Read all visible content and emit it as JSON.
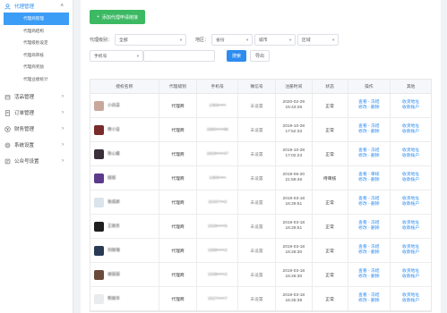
{
  "sidebar": {
    "groups": [
      {
        "label": "代理管理",
        "icon": "user-icon",
        "expanded": true
      },
      {
        "label": "活品管理",
        "icon": "box-icon"
      },
      {
        "label": "订单管理",
        "icon": "order-icon"
      },
      {
        "label": "财务管理",
        "icon": "money-icon"
      },
      {
        "label": "系统设置",
        "icon": "gear-icon"
      },
      {
        "label": "公众号设置",
        "icon": "wechat-icon"
      }
    ],
    "sub_items": [
      {
        "label": "代理商管理",
        "active": true
      },
      {
        "label": "代理商结构"
      },
      {
        "label": "代理级别设定"
      },
      {
        "label": "代理商审核"
      },
      {
        "label": "代理商奖励"
      },
      {
        "label": "代理业绩统计"
      }
    ]
  },
  "toolbar": {
    "add_label": "添加代理申请链接"
  },
  "filters": {
    "level_label": "代理级别：",
    "level_value": "全部",
    "region_label": "地区：",
    "province": "省份",
    "city": "城市",
    "district": "区域",
    "phone_select": "手机号",
    "search_label": "搜索",
    "export_label": "导出"
  },
  "table": {
    "headers": [
      "授权名称",
      "代理级别",
      "手机号",
      "微信号",
      "注册时间",
      "状态",
      "操作",
      "其他"
    ],
    "rows": [
      {
        "name": "小白菜",
        "level": "代理商",
        "phone": "1369•••••",
        "wechat": "未设置",
        "date": "2020-02-29",
        "time": "15:43:26",
        "status": "正常",
        "op1": "查看 - 冻结",
        "op2": "修改 - 删除",
        "other1": "收货地址",
        "other2": "收款账户",
        "avatar": "#c9a79a"
      },
      {
        "name": "荷小豆",
        "level": "代理商",
        "phone": "1890•••••86",
        "wechat": "未设置",
        "date": "2019-10-28",
        "time": "17:52:33",
        "status": "正常",
        "op1": "查看 - 冻结",
        "op2": "修改 - 删除",
        "other1": "收货地址",
        "other2": "收款账户",
        "avatar": "#7a2b2b"
      },
      {
        "name": "张心媛",
        "level": "代理商",
        "phone": "1829•••••47",
        "wechat": "未设置",
        "date": "2019-10-28",
        "time": "17:02:23",
        "status": "正常",
        "op1": "查看 - 冻结",
        "op2": "修改 - 删除",
        "other1": "收货地址",
        "other2": "收款账户",
        "avatar": "#3b2f3a"
      },
      {
        "name": "妞妞",
        "level": "代理商",
        "phone": "1369•••••",
        "wechat": "未设置",
        "date": "2019-06-20",
        "time": "21:59:46",
        "status": "待审核",
        "op1": "查看 - 审核",
        "op2": "修改 - 删除",
        "other1": "收货地址",
        "other2": "收款账户",
        "avatar": "#5c3a8c"
      },
      {
        "name": "张成新",
        "level": "代理商",
        "phone": "15347•••2",
        "wechat": "未设置",
        "date": "2019-03-18",
        "time": "16:29:51",
        "status": "正常",
        "op1": "查看 - 冻结",
        "op2": "修改 - 删除",
        "other1": "收货地址",
        "other2": "收款账户",
        "avatar": "#d9e4ec"
      },
      {
        "name": "王晓东",
        "level": "代理商",
        "phone": "1528•••••5",
        "wechat": "未设置",
        "date": "2019-03-18",
        "time": "16:29:51",
        "status": "正常",
        "op1": "查看 - 冻结",
        "op2": "修改 - 删除",
        "other1": "收货地址",
        "other2": "收款账户",
        "avatar": "#1f1f1f"
      },
      {
        "name": "刘晓瑞",
        "level": "代理商",
        "phone": "1588•••••2",
        "wechat": "未设置",
        "date": "2019-03-18",
        "time": "16:28:30",
        "status": "正常",
        "op1": "查看 - 冻结",
        "op2": "修改 - 删除",
        "other1": "收货地址",
        "other2": "收款账户",
        "avatar": "#2a3a55"
      },
      {
        "name": "谢丽丽",
        "level": "代理商",
        "phone": "1539•••••2",
        "wechat": "未设置",
        "date": "2019-03-18",
        "time": "16:26:30",
        "status": "正常",
        "op1": "查看 - 冻结",
        "op2": "修改 - 删除",
        "other1": "收货地址",
        "other2": "收款账户",
        "avatar": "#6b4a3a"
      },
      {
        "name": "熊晓华",
        "level": "代理商",
        "phone": "1527•••••7",
        "wechat": "未设置",
        "date": "2019-03-18",
        "time": "16:25:39",
        "status": "正常",
        "op1": "查看 - 冻结",
        "op2": "修改 - 删除",
        "other1": "收货地址",
        "other2": "收款账户",
        "avatar": "#e8ecef"
      }
    ]
  }
}
